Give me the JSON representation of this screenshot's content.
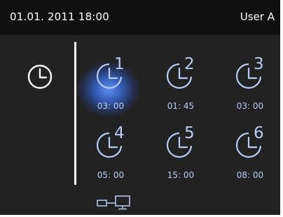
{
  "header": {
    "datetime": "01.01. 2011 18:00",
    "user": "User A"
  },
  "colors": {
    "background": "#222222",
    "topbar": "#111111",
    "accent": "#b9cdf2",
    "selected_glow": "#5f96ff"
  },
  "slots": [
    {
      "number": "1",
      "time": "03: 00",
      "selected": true
    },
    {
      "number": "2",
      "time": "01: 45",
      "selected": false
    },
    {
      "number": "3",
      "time": "03: 00",
      "selected": false
    },
    {
      "number": "4",
      "time": "05: 00",
      "selected": false
    },
    {
      "number": "5",
      "time": "15: 00",
      "selected": false
    },
    {
      "number": "6",
      "time": "08: 00",
      "selected": false
    }
  ],
  "icons": {
    "main": "clock-icon",
    "slot": "timer-clock-icon",
    "footer": "network-connection-icon"
  }
}
